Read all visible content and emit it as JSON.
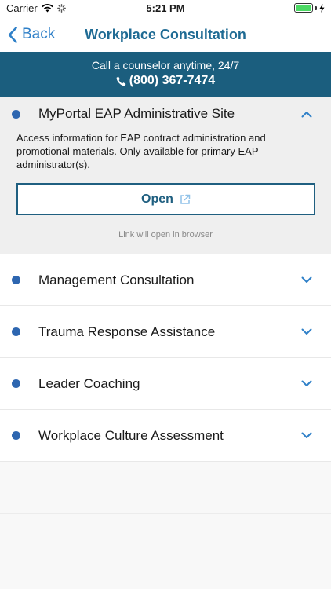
{
  "status_bar": {
    "carrier": "Carrier",
    "time": "5:21 PM",
    "wifi_icon": "wifi-icon",
    "activity_icon": "activity-spinner-icon",
    "battery_icon": "battery-icon",
    "charging_icon": "charging-bolt-icon"
  },
  "nav": {
    "back_label": "Back",
    "back_icon": "chevron-left-icon",
    "title": "Workplace Consultation"
  },
  "banner": {
    "line1": "Call a counselor anytime, 24/7",
    "phone": "(800) 367-7474",
    "phone_icon": "phone-icon"
  },
  "expanded_item": {
    "title": "MyPortal EAP Administrative Site",
    "description": "Access information for EAP contract administration and promotional materials. Only available for primary EAP administrator(s).",
    "button_label": "Open",
    "button_icon": "external-link-icon",
    "note": "Link will open in browser",
    "toggle_icon": "chevron-up-icon"
  },
  "items": [
    {
      "title": "Management Consultation",
      "toggle_icon": "chevron-down-icon"
    },
    {
      "title": "Trauma Response Assistance",
      "toggle_icon": "chevron-down-icon"
    },
    {
      "title": "Leader Coaching",
      "toggle_icon": "chevron-down-icon"
    },
    {
      "title": "Workplace Culture Assessment",
      "toggle_icon": "chevron-down-icon"
    }
  ],
  "colors": {
    "accent": "#2f80c8",
    "nav_title": "#1f6b94",
    "banner_bg": "#1b5e7e",
    "dot": "#2d66b0",
    "button_border": "#1f5f80"
  }
}
